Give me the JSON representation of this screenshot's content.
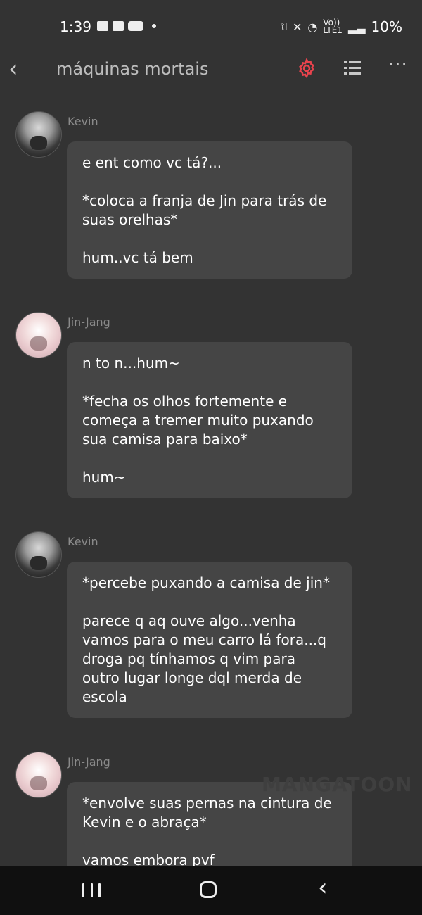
{
  "status_bar": {
    "time": "1:39",
    "battery": "10%",
    "network": "LTE1",
    "volte": "Vo))"
  },
  "header": {
    "title": "máquinas mortais",
    "back_icon": "‹",
    "more_icon": "···"
  },
  "colors": {
    "background": "#333333",
    "bubble": "#454545",
    "accent": "#e8434d",
    "sender": "#8a8a8a"
  },
  "messages": [
    {
      "sender": "Kevin",
      "paragraphs": [
        "e ent como vc tá?...",
        "*coloca a franja de Jin para trás de suas orelhas*",
        "hum..vc tá bem"
      ]
    },
    {
      "sender": "Jin-Jang",
      "paragraphs": [
        "n to n...hum~",
        "*fecha os olhos fortemente e começa a tremer muito puxando sua camisa para baixo*",
        "hum~"
      ]
    },
    {
      "sender": "Kevin",
      "paragraphs": [
        "*percebe puxando a camisa de jin*",
        "parece q aq ouve algo...venha vamos para o meu carro lá fora...q droga pq tínhamos q vim para outro lugar longe dql merda de escola"
      ]
    },
    {
      "sender": "Jin-Jang",
      "paragraphs": [
        "*envolve suas pernas na cintura de Kevin e o abraça*",
        "vamos embora pvf"
      ]
    }
  ],
  "watermark": "MANGATOON"
}
